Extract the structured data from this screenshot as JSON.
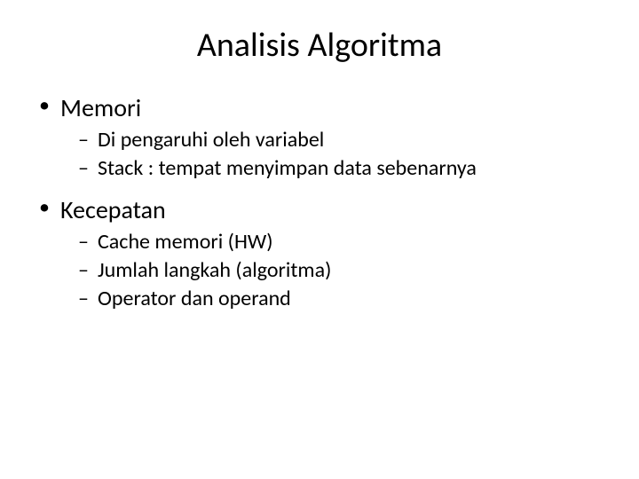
{
  "title": "Analisis Algoritma",
  "items": [
    {
      "label": "Memori",
      "sub": [
        "Di pengaruhi oleh variabel",
        "Stack : tempat menyimpan data sebenarnya"
      ]
    },
    {
      "label": "Kecepatan",
      "sub": [
        "Cache memori (HW)",
        "Jumlah langkah (algoritma)",
        "Operator dan operand"
      ]
    }
  ]
}
